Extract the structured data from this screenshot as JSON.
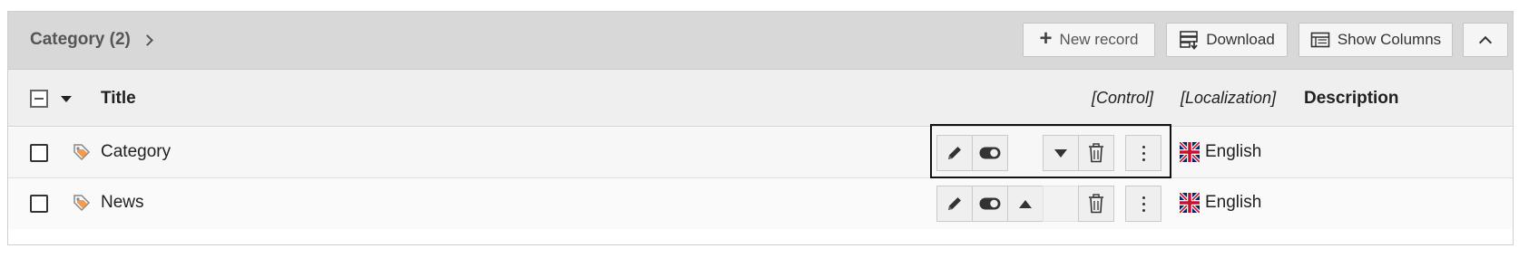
{
  "header": {
    "title": "Category (2)",
    "buttons": {
      "new_record": "New record",
      "download": "Download",
      "show_columns": "Show Columns"
    }
  },
  "columns": {
    "title": "Title",
    "control": "[Control]",
    "localization": "[Localization]",
    "description": "Description"
  },
  "rows": [
    {
      "title": "Category",
      "language": "English",
      "move": "down",
      "focused": true
    },
    {
      "title": "News",
      "language": "English",
      "move": "up",
      "focused": false
    }
  ],
  "colors": {
    "header_bg": "#d8d8d8",
    "column_header_bg": "#efefef",
    "tag_icon": "#f28a2e",
    "button_bg": "#efefef"
  },
  "icons": [
    "chevron-right-icon",
    "plus-icon",
    "download-icon",
    "columns-icon",
    "chevron-up-icon",
    "tag-icon",
    "pencil-icon",
    "toggle-icon",
    "arrow-down-icon",
    "arrow-up-icon",
    "trash-icon",
    "more-icon",
    "uk-flag-icon"
  ]
}
